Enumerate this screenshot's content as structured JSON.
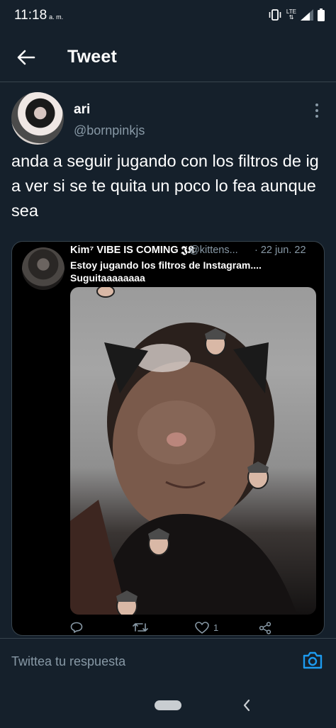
{
  "status_bar": {
    "time": "11:18",
    "ampm": "a. m.",
    "network": "LTE"
  },
  "header": {
    "title": "Tweet",
    "back_icon": "arrow-left-icon"
  },
  "tweet": {
    "display_name": "ari",
    "handle": "@bornpinkjs",
    "text": "anda a seguir jugando con los filtros de ig a ver si se te quita un poco lo fea aunque sea"
  },
  "quoted_tweet": {
    "display_name": "Kim⁷ VIBE IS COMING 𝕵𝕶",
    "handle": "@kittens...",
    "date": "· 22 jun. 22",
    "text": "Estoy jugando los filtros de Instagram.... Suguitaaaaaaaa",
    "actions": {
      "reply_count": "",
      "retweet_count": "",
      "like_count": "1"
    }
  },
  "reply_bar": {
    "placeholder": "Twittea tu respuesta"
  },
  "colors": {
    "background": "#15202b",
    "accent": "#1d9bf0",
    "secondary_text": "#8899a6",
    "border": "#38444d"
  }
}
